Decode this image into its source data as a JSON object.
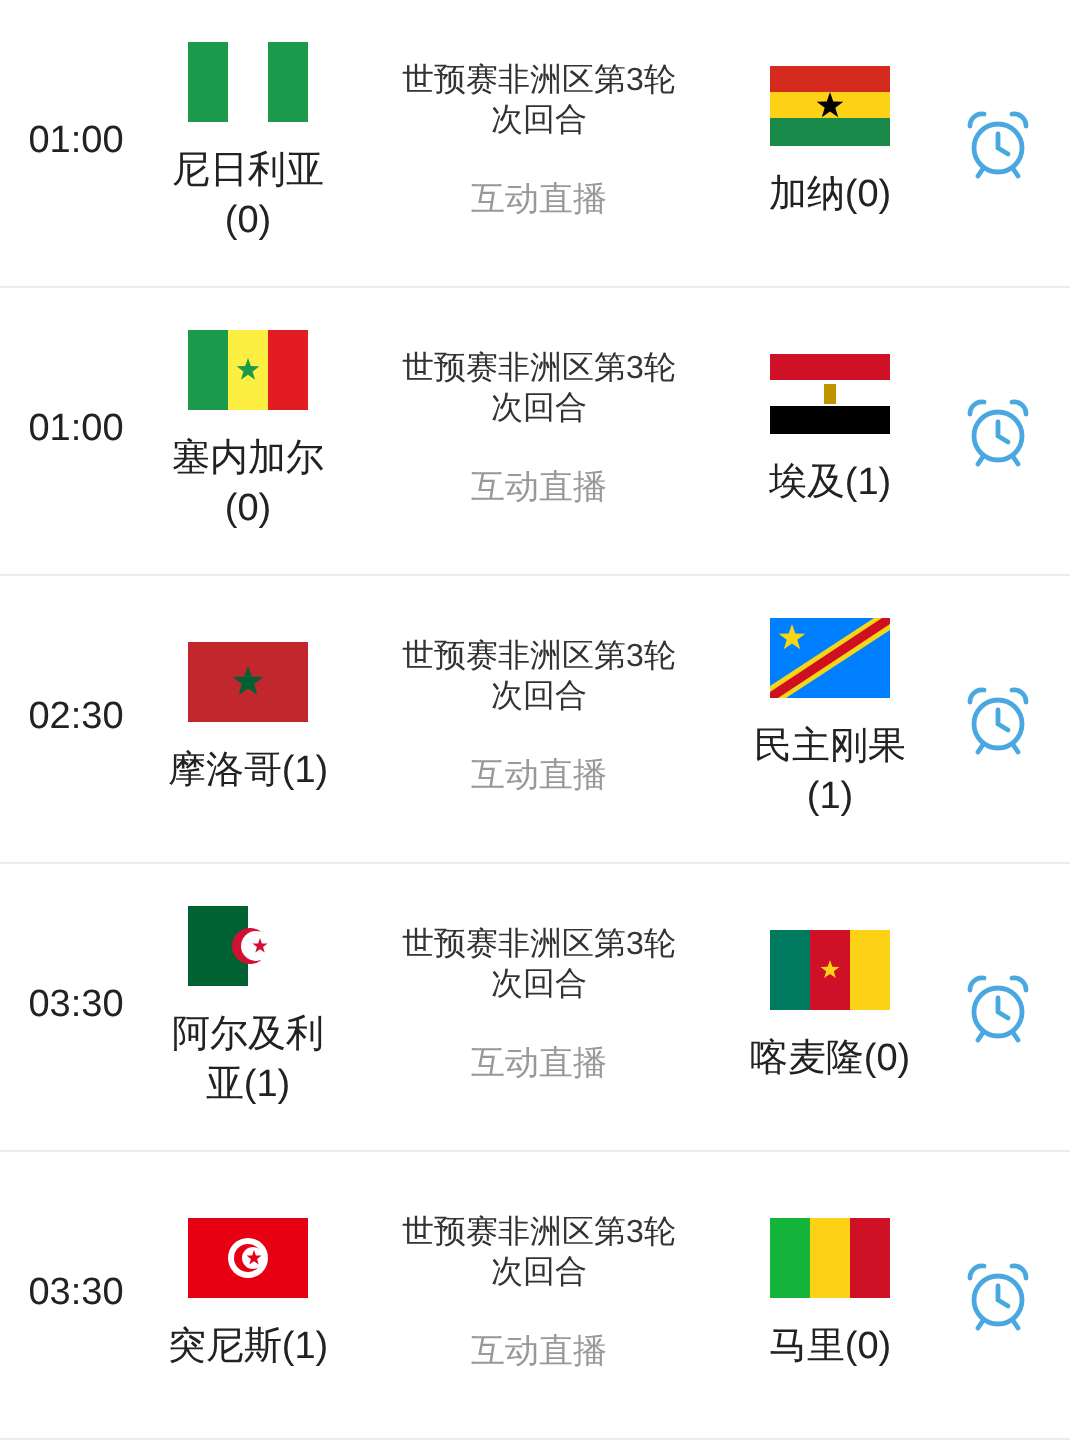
{
  "matches": [
    {
      "time": "01:00",
      "competition": "世预赛非洲区第3轮次回合",
      "live": "互动直播",
      "home": {
        "name": "尼日利亚(0)",
        "kind": "nigeria"
      },
      "away": {
        "name": "加纳(0)",
        "kind": "ghana"
      }
    },
    {
      "time": "01:00",
      "competition": "世预赛非洲区第3轮次回合",
      "live": "互动直播",
      "home": {
        "name": "塞内加尔(0)",
        "kind": "senegal"
      },
      "away": {
        "name": "埃及(1)",
        "kind": "egypt"
      }
    },
    {
      "time": "02:30",
      "competition": "世预赛非洲区第3轮次回合",
      "live": "互动直播",
      "home": {
        "name": "摩洛哥(1)",
        "kind": "morocco"
      },
      "away": {
        "name": "民主刚果(1)",
        "kind": "drcongo"
      }
    },
    {
      "time": "03:30",
      "competition": "世预赛非洲区第3轮次回合",
      "live": "互动直播",
      "home": {
        "name": "阿尔及利亚(1)",
        "kind": "algeria"
      },
      "away": {
        "name": "喀麦隆(0)",
        "kind": "cameroon"
      }
    },
    {
      "time": "03:30",
      "competition": "世预赛非洲区第3轮次回合",
      "live": "互动直播",
      "home": {
        "name": "突尼斯(1)",
        "kind": "tunisia"
      },
      "away": {
        "name": "马里(0)",
        "kind": "mali"
      }
    }
  ]
}
